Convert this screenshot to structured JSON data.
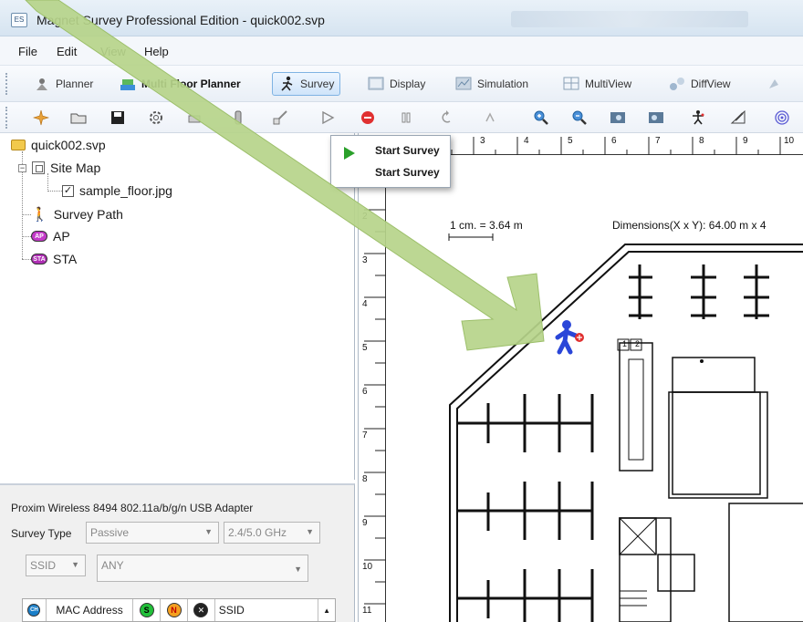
{
  "window": {
    "title": "Magnet Survey Professional Edition - quick002.svp",
    "icon_text": "ES"
  },
  "menu": [
    "File",
    "Edit",
    "View",
    "Help"
  ],
  "toolbar1": {
    "items": [
      {
        "label": "Planner",
        "icon": "planner-icon",
        "active": false
      },
      {
        "label": "Multi Floor Planner",
        "icon": "multi-floor-icon",
        "active": false
      },
      {
        "label": "Survey",
        "icon": "survey-icon",
        "active": true
      },
      {
        "label": "Display",
        "icon": "display-icon",
        "active": false
      },
      {
        "label": "Simulation",
        "icon": "simulation-icon",
        "active": false
      },
      {
        "label": "MultiView",
        "icon": "multiview-icon",
        "active": false
      },
      {
        "label": "DiffView",
        "icon": "diffview-icon",
        "active": false
      }
    ]
  },
  "toolbar2": {
    "icons": [
      "new-icon",
      "open-icon",
      "save-icon",
      "settings-icon",
      "print-icon",
      "adapter-icon",
      "edit-path-icon",
      "play-icon",
      "stop-icon",
      "pause-icon",
      "undo-icon",
      "redo-icon",
      "zoom-in-icon",
      "zoom-out-icon",
      "fit-icon",
      "zoom-area-icon",
      "walker-icon",
      "draw-icon",
      "signal-icon"
    ]
  },
  "tree": {
    "root": "quick002.svp",
    "site_map": "Site Map",
    "floor_image": "sample_floor.jpg",
    "survey_path": "Survey Path",
    "ap": "AP",
    "sta": "STA",
    "ap_badge": "AP",
    "sta_badge": "STA"
  },
  "survey_panel": {
    "adapter": "Proxim Wireless 8494 802.11a/b/g/n USB Adapter",
    "survey_type_label": "Survey Type",
    "survey_type_value": "Passive",
    "band_value": "2.4/5.0 GHz",
    "filter_field": "SSID",
    "filter_value": "ANY",
    "columns": {
      "ch": "CH",
      "mac": "MAC Address",
      "s_badge": "S",
      "n_badge": "N",
      "ssid": "SSID"
    }
  },
  "popup": {
    "title": "Start Survey",
    "description": "Start Survey"
  },
  "canvas": {
    "ruler_top": [
      "3",
      "4",
      "5",
      "6",
      "7",
      "8",
      "9",
      "10"
    ],
    "ruler_left": [
      "2",
      "3",
      "4",
      "5",
      "6",
      "7",
      "8",
      "9",
      "10",
      "11"
    ],
    "scale": "1 cm. = 3.64 m",
    "dimensions": "Dimensions(X x Y): 64.00 m x 4",
    "room_labels": [
      "1",
      "2"
    ]
  },
  "colors": {
    "accent": "#7fb3e3",
    "arrow": "#b6d48a",
    "canvas_bg": "#6b88a6"
  }
}
